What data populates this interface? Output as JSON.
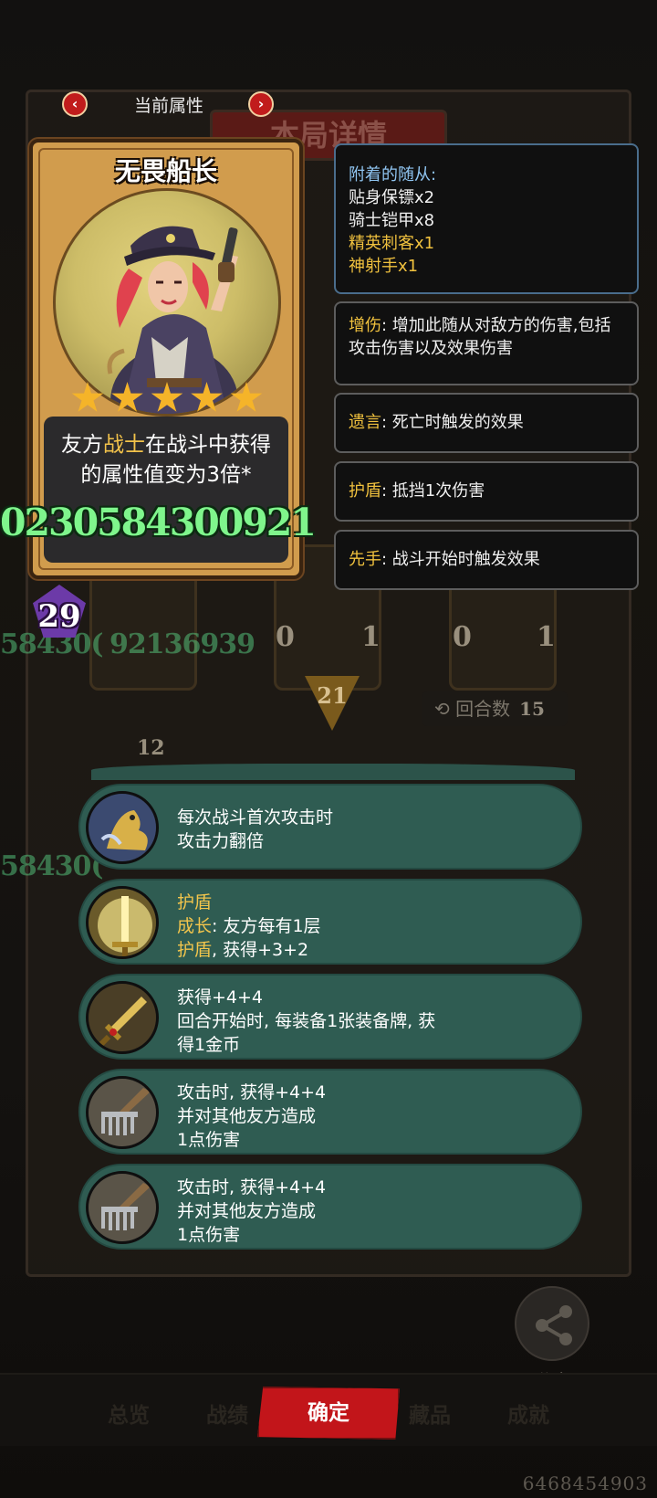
{
  "header": {
    "title": "当前属性",
    "prev_icon": "‹",
    "next_icon": "›"
  },
  "background": {
    "window_title": "本局详情",
    "turn_badge": "21",
    "rounds_label": "回合数",
    "rounds_value": "15",
    "green_numbers": [
      "58430(",
      "92136939",
      "58430("
    ],
    "card_stats": [
      "0",
      "1",
      "0",
      "1",
      "12"
    ]
  },
  "hero": {
    "name": "无畏船长",
    "stars": 5,
    "desc_prefix": "友方",
    "desc_keyword": "战士",
    "desc_mid": "在战斗中获得",
    "desc_line2": "的属性值变为3倍*",
    "overlay_number": "0230584300921",
    "level": "29"
  },
  "companions": {
    "title": "附着的随从:",
    "items": [
      {
        "name": "贴身保镖",
        "count": "x2",
        "color": "#f0f0f0"
      },
      {
        "name": "骑士铠甲",
        "count": "x8",
        "color": "#f0f0f0"
      },
      {
        "name": "精英刺客",
        "count": "x1",
        "color": "#f0c13e"
      },
      {
        "name": "神射手",
        "count": "x1",
        "color": "#f0c13e"
      }
    ]
  },
  "keywords": [
    {
      "name": "增伤",
      "desc": ": 增加此随从对敌方的伤害,包括攻击伤害以及效果伤害"
    },
    {
      "name": "遗言",
      "desc": ": 死亡时触发的效果"
    },
    {
      "name": "护盾",
      "desc": ": 抵挡1次伤害"
    },
    {
      "name": "先手",
      "desc": ": 战斗开始时触发效果"
    }
  ],
  "abilities": [
    {
      "icon": "gold-dragon-icon",
      "lines": [
        "每次战斗首次攻击时",
        "攻击力翻倍"
      ]
    },
    {
      "icon": "golden-sword-icon",
      "lines_rich": [
        [
          {
            "t": "护盾",
            "k": true
          }
        ],
        [
          {
            "t": "成长",
            "k": true
          },
          {
            "t": ": 友方每有1层",
            "k": false
          }
        ],
        [
          {
            "t": "护盾",
            "k": true
          },
          {
            "t": ", 获得+3+2",
            "k": false
          }
        ]
      ]
    },
    {
      "icon": "jeweled-sword-icon",
      "lines": [
        "获得+4+4",
        "回合开始时, 每装备1张装备牌, 获",
        "得1金币"
      ]
    },
    {
      "icon": "rake-icon",
      "lines": [
        "攻击时, 获得+4+4",
        "并对其他友方造成",
        "1点伤害"
      ]
    },
    {
      "icon": "rake-icon",
      "lines": [
        "攻击时, 获得+4+4",
        "并对其他友方造成",
        "1点伤害"
      ]
    }
  ],
  "share": {
    "label": "分享"
  },
  "bottom": {
    "tabs": [
      "总览",
      "战绩",
      "藏品",
      "成就"
    ],
    "confirm": "确定"
  },
  "footer_id": "6468454903",
  "colors": {
    "keyword": "#f0c13e",
    "panel_border": "#5d5d5d",
    "ability_bg": "#2f5c52",
    "confirm": "#c2151a",
    "card_gold": "#d19c4d"
  }
}
